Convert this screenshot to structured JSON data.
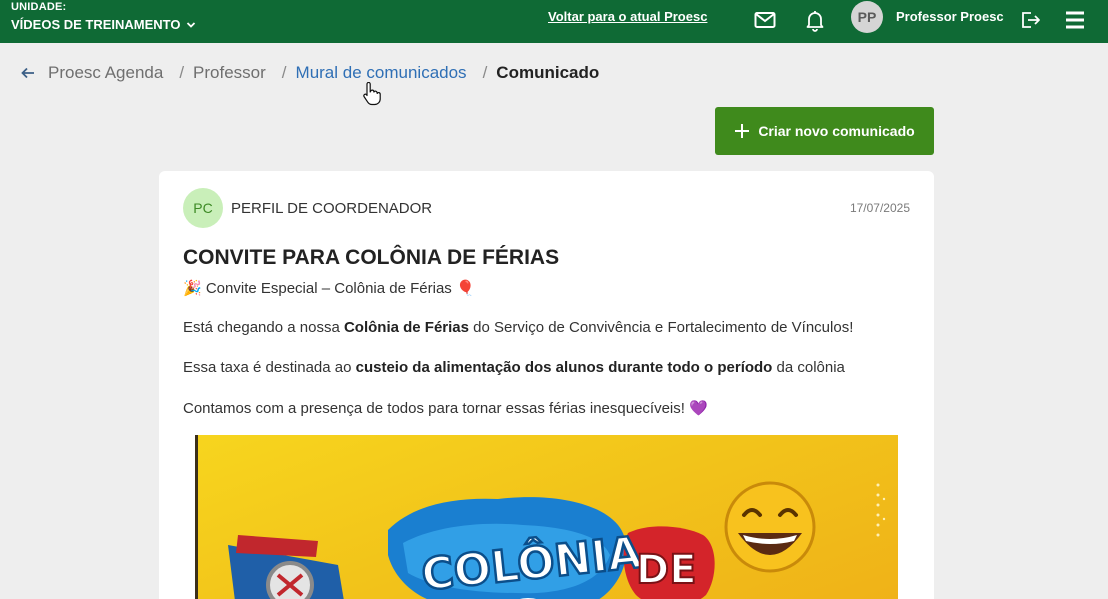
{
  "topbar": {
    "unit_label": "UNIDADE:",
    "unit_value": "VÍDEOS DE TREINAMENTO",
    "back_link": "Voltar para o atual Proesc",
    "user_initials": "PP",
    "user_name": "Professor Proesc",
    "icons": [
      "chevron-down-icon",
      "mail-icon",
      "bell-icon",
      "logout-icon",
      "menu-icon"
    ],
    "color": "#0f6a35"
  },
  "breadcrumb": {
    "items": [
      "Proesc Agenda",
      "Professor",
      "Mural de comunicados",
      "Comunicado"
    ],
    "separator": "/"
  },
  "actions": {
    "create_label": "Criar novo comunicado",
    "color": "#3f8a1c"
  },
  "post": {
    "author_initials": "PC",
    "author_name": "PERFIL DE COORDENADOR",
    "date": "17/07/2025",
    "title": "CONVITE PARA COLÔNIA DE FÉRIAS",
    "subtitle": "🎉 Convite Especial – Colônia de Férias 🎈",
    "p1_before": "Está chegando a nossa ",
    "p1_bold": "Colônia de Férias",
    "p1_after": " do Serviço de Convivência e Fortalecimento de Vínculos!",
    "p2_before": "Essa taxa é destinada ao ",
    "p2_bold": "custeio da alimentação dos alunos durante todo o período",
    "p2_after": " da colônia",
    "p3": "Contamos com a presença de todos para tornar essas férias inesquecíveis! 💜",
    "banner_text_1": "COLÔNIA",
    "banner_text_2": "DE"
  }
}
